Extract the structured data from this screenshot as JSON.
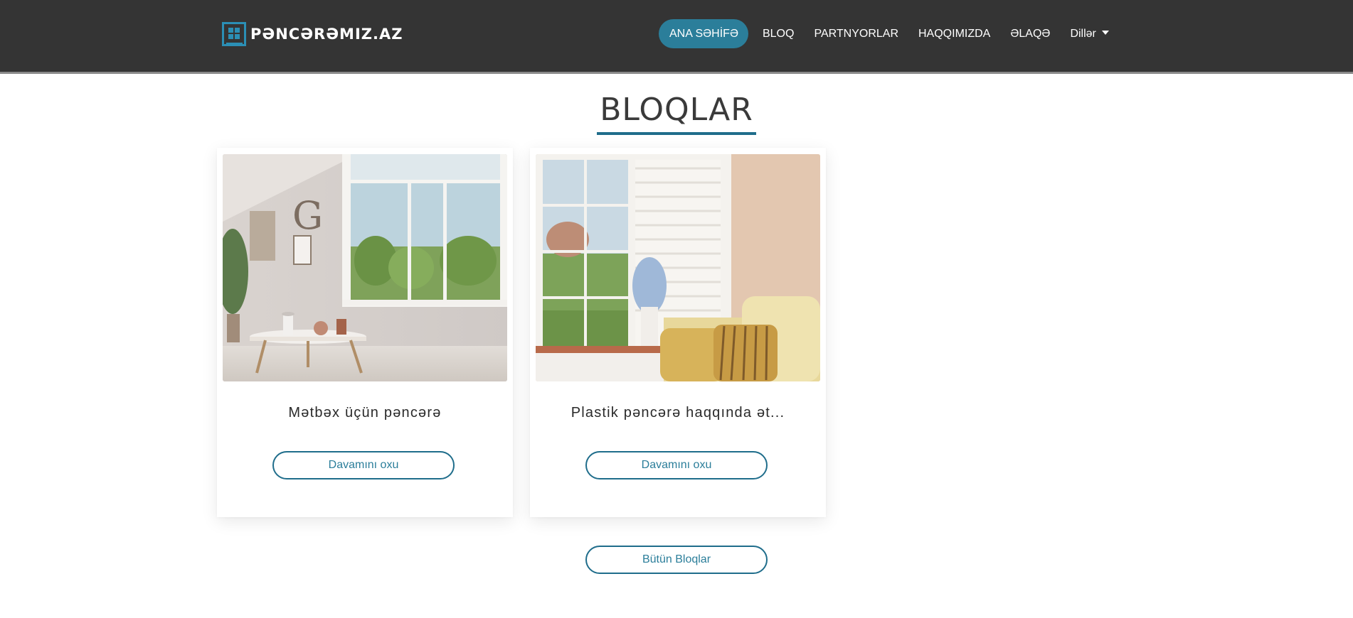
{
  "brand": {
    "name": "PƏNCƏRƏMIZ.AZ"
  },
  "nav": {
    "items": [
      {
        "label": "ANA SƏHİFƏ",
        "active": true
      },
      {
        "label": "BLOQ"
      },
      {
        "label": "PARTNYORLAR"
      },
      {
        "label": "HAQQIMIZDA"
      },
      {
        "label": "ƏLAQƏ"
      }
    ],
    "languages_label": "Dillər"
  },
  "section": {
    "title": "BLOQLAR"
  },
  "posts": [
    {
      "title": "Mətbəx üçün pəncərə",
      "button": "Davamını oxu",
      "image": "bright-room-with-window-and-coffee-table"
    },
    {
      "title": "Plastik pəncərə haqqında ət...",
      "button": "Davamını oxu",
      "image": "window-with-blinds-and-yellow-sofa"
    }
  ],
  "all_blogs_button": "Bütün Bloqlar",
  "colors": {
    "header_bg": "#343434",
    "accent": "#2b7e9a",
    "accent_dark": "#1f6d8b",
    "text": "#2a2a2a"
  }
}
